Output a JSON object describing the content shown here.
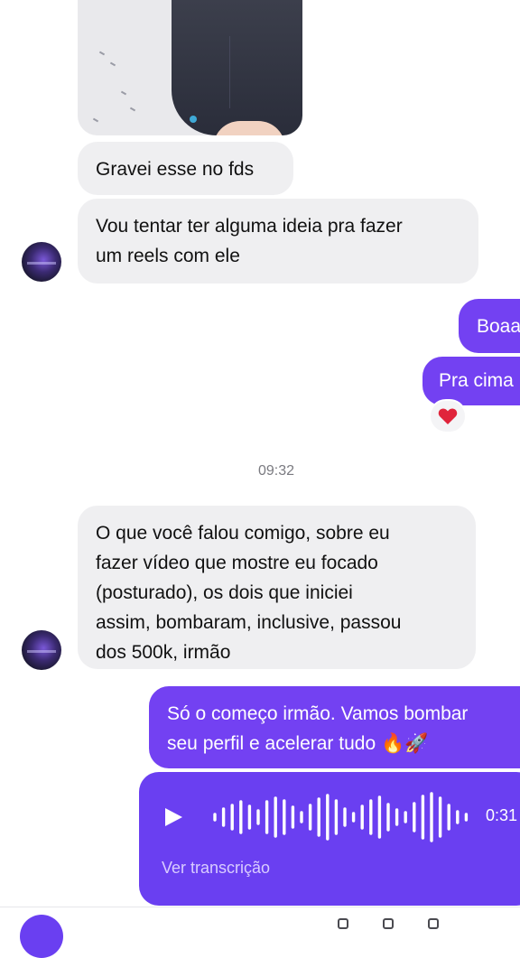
{
  "conversation": {
    "photo": {
      "icon": "sent-photo"
    },
    "messages": [
      {
        "id": "m1",
        "direction": "incoming",
        "text": "Gravei esse no fds"
      },
      {
        "id": "m2",
        "direction": "incoming",
        "lines": [
          "Vou tentar ter alguma ideia pra fazer",
          "um reels com ele"
        ]
      },
      {
        "id": "m3",
        "direction": "outgoing",
        "text": "Boaa"
      },
      {
        "id": "m4",
        "direction": "outgoing",
        "text": "Pra cima",
        "reaction": "❤️"
      },
      {
        "id": "timestamp",
        "text": "09:32"
      },
      {
        "id": "m5",
        "direction": "incoming",
        "lines": [
          "O que você falou comigo, sobre eu",
          "fazer vídeo que mostre eu focado",
          "(posturado), os dois que iniciei",
          "assim, bombaram, inclusive, passou",
          "dos 500k, irmão"
        ]
      },
      {
        "id": "m6",
        "direction": "outgoing",
        "lines": [
          "Só o começo irmão. Vamos bombar",
          "seu perfil e acelerar tudo 🔥🚀"
        ]
      }
    ],
    "voice_message": {
      "duration": "0:31",
      "transcription_label": "Ver transcrição"
    }
  },
  "colors": {
    "incoming_bubble": "#efeff1",
    "outgoing_bubble": "#7341f2",
    "voice_bubble": "#6a3ff1",
    "timestamp": "#7a7a80"
  },
  "icons": {
    "play": "play-icon",
    "reaction": "heart-icon",
    "avatar": "contact-avatar"
  }
}
